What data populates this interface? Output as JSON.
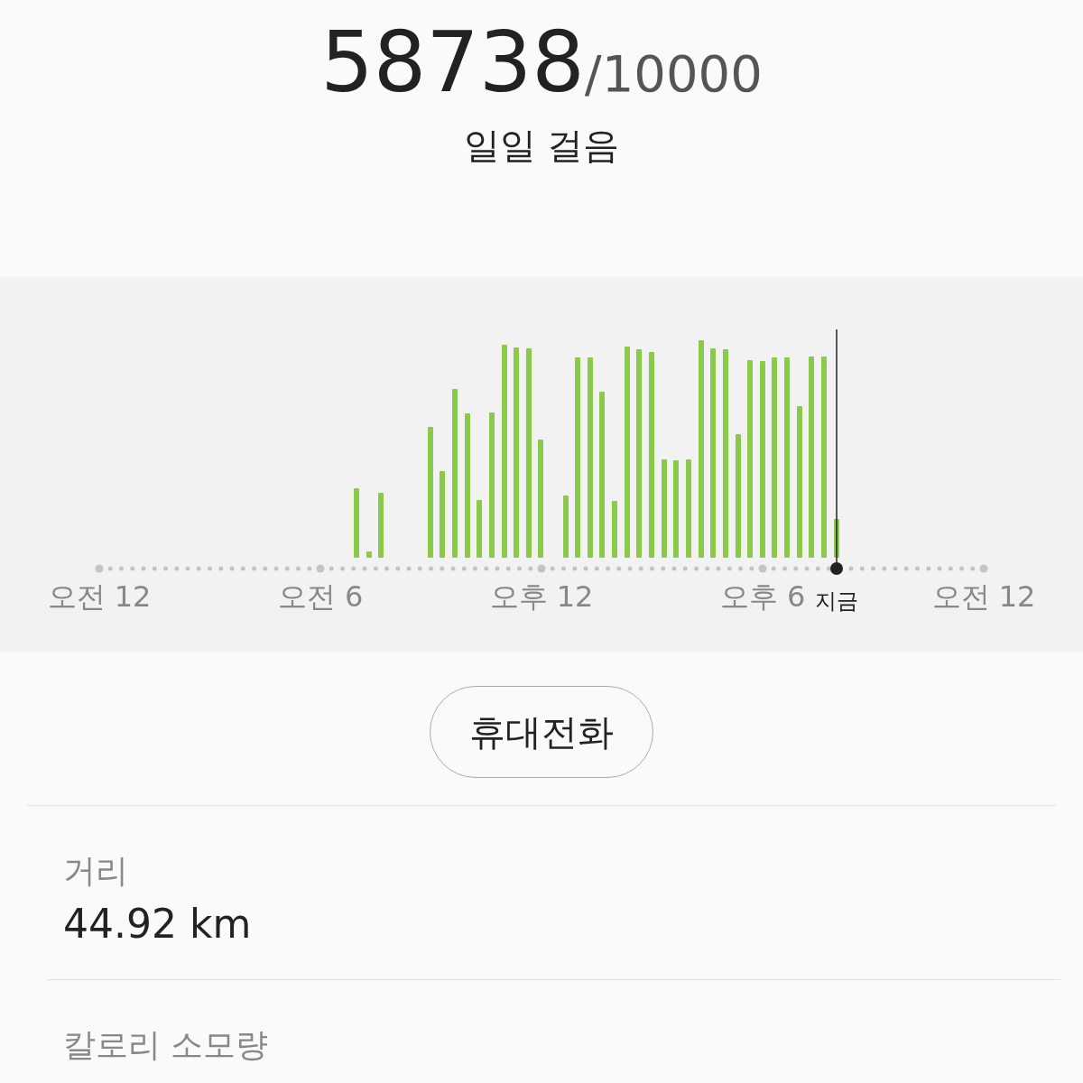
{
  "steps": {
    "count": "58738",
    "goal": "/10000",
    "label": "일일 걸음"
  },
  "chart": {
    "axis_labels": [
      "오전 12",
      "오전 6",
      "오후 12",
      "오후 6",
      "오전 12"
    ],
    "now_label": "지금"
  },
  "device_button": "휴대전화",
  "stats": [
    {
      "label": "거리",
      "value": "44.92 km"
    },
    {
      "label": "칼로리 소모량"
    }
  ]
}
